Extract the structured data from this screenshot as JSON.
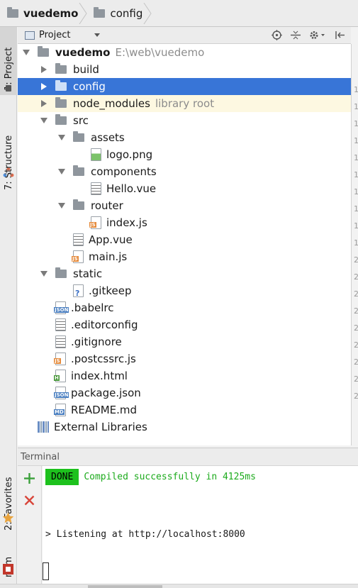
{
  "breadcrumb": {
    "project": "vuedemo",
    "folder": "config"
  },
  "left_strip": {
    "project_tab": "1: Project",
    "structure_tab": "7: Structure",
    "favorites_tab": "2: Favorites",
    "npm_tab": "npm"
  },
  "project_toolbar": {
    "view_label": "Project",
    "icons": [
      "locate-icon",
      "collapse-all-icon",
      "settings-icon",
      "hide-icon"
    ]
  },
  "tree": {
    "root": {
      "name": "vuedemo",
      "path": "E:\\web\\vuedemo"
    },
    "items": [
      {
        "name": "build",
        "type": "folder"
      },
      {
        "name": "config",
        "type": "folder",
        "selected": true
      },
      {
        "name": "node_modules",
        "type": "folder",
        "hint": "library root"
      },
      {
        "name": "src",
        "type": "folder",
        "expanded": true
      },
      {
        "name": "assets",
        "type": "folder"
      },
      {
        "name": "logo.png",
        "type": "image"
      },
      {
        "name": "components",
        "type": "folder"
      },
      {
        "name": "Hello.vue",
        "type": "text"
      },
      {
        "name": "router",
        "type": "folder"
      },
      {
        "name": "index.js",
        "type": "js"
      },
      {
        "name": "App.vue",
        "type": "text"
      },
      {
        "name": "main.js",
        "type": "js"
      },
      {
        "name": "static",
        "type": "folder"
      },
      {
        "name": ".gitkeep",
        "type": "unknown"
      },
      {
        "name": ".babelrc",
        "type": "json"
      },
      {
        "name": ".editorconfig",
        "type": "text"
      },
      {
        "name": ".gitignore",
        "type": "text"
      },
      {
        "name": ".postcssrc.js",
        "type": "js"
      },
      {
        "name": "index.html",
        "type": "html"
      },
      {
        "name": "package.json",
        "type": "json"
      },
      {
        "name": "README.md",
        "type": "md"
      },
      {
        "name": "External Libraries",
        "type": "libraries"
      }
    ]
  },
  "gutter_lines": [
    "1",
    "1",
    "1",
    "1",
    "1",
    "1",
    "1",
    "1",
    "1",
    "1",
    "2",
    "2",
    "2",
    "2",
    "2",
    "2",
    "2",
    "2",
    "2"
  ],
  "terminal": {
    "title": "Terminal",
    "done_badge": "DONE",
    "compiled_message": "Compiled successfully in 4125ms",
    "listening_message": "> Listening at http://localhost:8000",
    "tool_icons": [
      "add-icon",
      "close-icon"
    ]
  },
  "colors": {
    "selection": "#3875d7",
    "done_bg": "#1dc11d",
    "compiled_text": "#1dab1d",
    "library_row": "#fdf8e1"
  }
}
